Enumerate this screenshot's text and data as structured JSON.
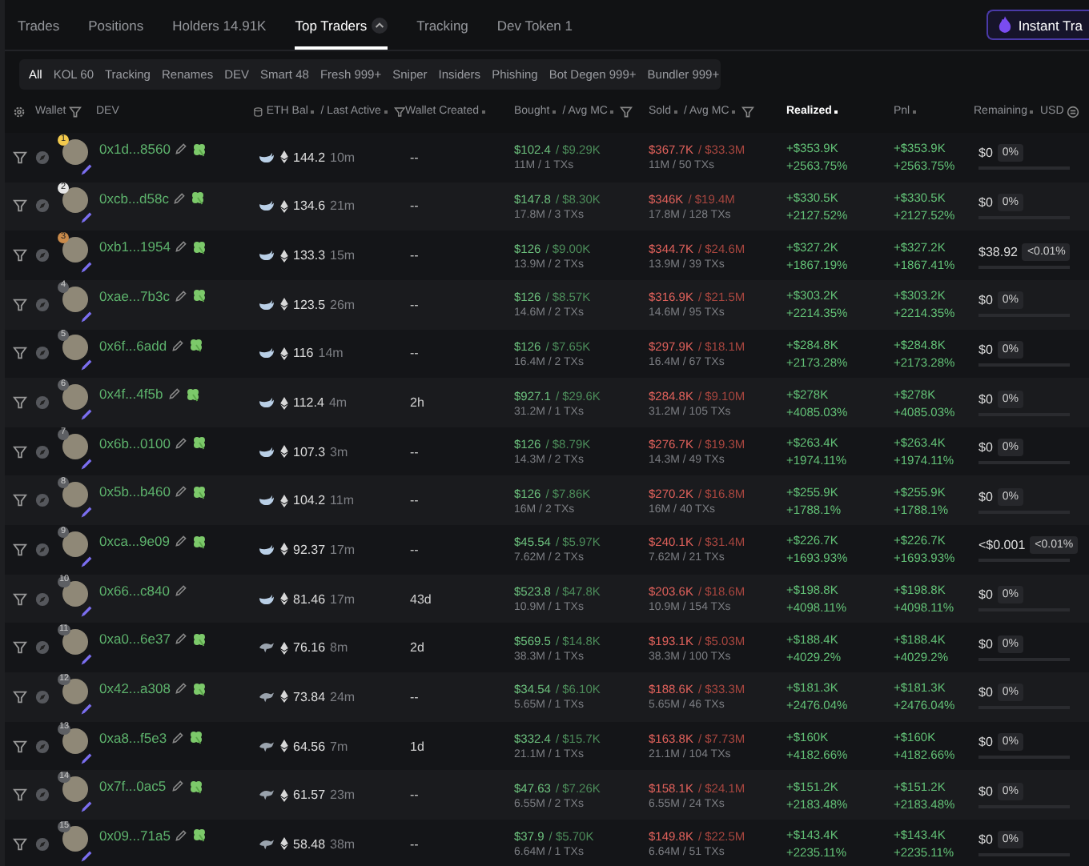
{
  "tabs": [
    {
      "label": "Trades",
      "selected": false
    },
    {
      "label": "Positions",
      "selected": false
    },
    {
      "label": "Holders 14.91K",
      "selected": false
    },
    {
      "label": "Top Traders",
      "selected": true,
      "caret": true
    },
    {
      "label": "Tracking",
      "selected": false
    },
    {
      "label": "Dev Token 1",
      "selected": false
    }
  ],
  "instant_trade_button": "Instant Tra",
  "filters": [
    {
      "label": "All",
      "selected": true
    },
    {
      "label": "KOL 60",
      "selected": false
    },
    {
      "label": "Tracking",
      "selected": false
    },
    {
      "label": "Renames",
      "selected": false
    },
    {
      "label": "DEV",
      "selected": false
    },
    {
      "label": "Smart 48",
      "selected": false
    },
    {
      "label": "Fresh 999+",
      "selected": false
    },
    {
      "label": "Sniper",
      "selected": false
    },
    {
      "label": "Insiders",
      "selected": false
    },
    {
      "label": "Phishing",
      "selected": false
    },
    {
      "label": "Bot Degen 999+",
      "selected": false
    },
    {
      "label": "Bundler 999+",
      "selected": false
    }
  ],
  "columns": {
    "wallet": "Wallet",
    "dev": "DEV",
    "eth_bal": "ETH Bal",
    "last_active": "/ Last Active",
    "wallet_created": "Wallet Created",
    "bought": "Bought",
    "bought_mc": "/ Avg MC",
    "sold": "Sold",
    "sold_mc": "/ Avg MC",
    "realized": "Realized",
    "pnl": "Pnl",
    "remaining": "Remaining",
    "usd": "USD"
  },
  "rows": [
    {
      "rank": "1",
      "wallet": "0x1d...8560",
      "tagged": true,
      "kind": "whale",
      "eth": "144.2",
      "active": "10m",
      "created": "--",
      "bought": "$102.4",
      "bought_mc": "/ $9.29K",
      "bought_sub": "11M / 1 TXs",
      "sold": "$367.7K",
      "sold_mc": "/ $33.3M",
      "sold_sub": "11M / 50 TXs",
      "realized": "+$353.9K",
      "realized_pct": "+2563.75%",
      "pnl": "+$353.9K",
      "pnl_pct": "+2563.75%",
      "remaining": "$0",
      "remaining_pct": "0%"
    },
    {
      "rank": "2",
      "wallet": "0xcb...d58c",
      "tagged": true,
      "kind": "whale",
      "eth": "134.6",
      "active": "21m",
      "created": "--",
      "bought": "$147.8",
      "bought_mc": "/ $8.30K",
      "bought_sub": "17.8M / 3 TXs",
      "sold": "$346K",
      "sold_mc": "/ $19.4M",
      "sold_sub": "17.8M / 128 TXs",
      "realized": "+$330.5K",
      "realized_pct": "+2127.52%",
      "pnl": "+$330.5K",
      "pnl_pct": "+2127.52%",
      "remaining": "$0",
      "remaining_pct": "0%"
    },
    {
      "rank": "3",
      "wallet": "0xb1...1954",
      "tagged": true,
      "kind": "whale",
      "eth": "133.3",
      "active": "15m",
      "created": "--",
      "bought": "$126",
      "bought_mc": "/ $9.00K",
      "bought_sub": "13.9M / 2 TXs",
      "sold": "$344.7K",
      "sold_mc": "/ $24.6M",
      "sold_sub": "13.9M / 39 TXs",
      "realized": "+$327.2K",
      "realized_pct": "+1867.19%",
      "pnl": "+$327.2K",
      "pnl_pct": "+1867.41%",
      "remaining": "$38.92",
      "remaining_pct": "<0.01%"
    },
    {
      "rank": "4",
      "wallet": "0xae...7b3c",
      "tagged": true,
      "kind": "whale",
      "eth": "123.5",
      "active": "26m",
      "created": "--",
      "bought": "$126",
      "bought_mc": "/ $8.57K",
      "bought_sub": "14.6M / 2 TXs",
      "sold": "$316.9K",
      "sold_mc": "/ $21.5M",
      "sold_sub": "14.6M / 95 TXs",
      "realized": "+$303.2K",
      "realized_pct": "+2214.35%",
      "pnl": "+$303.2K",
      "pnl_pct": "+2214.35%",
      "remaining": "$0",
      "remaining_pct": "0%"
    },
    {
      "rank": "5",
      "wallet": "0x6f...6add",
      "tagged": true,
      "kind": "whale",
      "eth": "116",
      "active": "14m",
      "created": "--",
      "bought": "$126",
      "bought_mc": "/ $7.65K",
      "bought_sub": "16.4M / 2 TXs",
      "sold": "$297.9K",
      "sold_mc": "/ $18.1M",
      "sold_sub": "16.4M / 67 TXs",
      "realized": "+$284.8K",
      "realized_pct": "+2173.28%",
      "pnl": "+$284.8K",
      "pnl_pct": "+2173.28%",
      "remaining": "$0",
      "remaining_pct": "0%"
    },
    {
      "rank": "6",
      "wallet": "0x4f...4f5b",
      "tagged": true,
      "kind": "whale",
      "eth": "112.4",
      "active": "4m",
      "created": "2h",
      "bought": "$927.1",
      "bought_mc": "/ $29.6K",
      "bought_sub": "31.2M / 1 TXs",
      "sold": "$284.8K",
      "sold_mc": "/ $9.10M",
      "sold_sub": "31.2M / 105 TXs",
      "realized": "+$278K",
      "realized_pct": "+4085.03%",
      "pnl": "+$278K",
      "pnl_pct": "+4085.03%",
      "remaining": "$0",
      "remaining_pct": "0%"
    },
    {
      "rank": "7",
      "wallet": "0x6b...0100",
      "tagged": true,
      "kind": "whale",
      "eth": "107.3",
      "active": "3m",
      "created": "--",
      "bought": "$126",
      "bought_mc": "/ $8.79K",
      "bought_sub": "14.3M / 2 TXs",
      "sold": "$276.7K",
      "sold_mc": "/ $19.3M",
      "sold_sub": "14.3M / 49 TXs",
      "realized": "+$263.4K",
      "realized_pct": "+1974.11%",
      "pnl": "+$263.4K",
      "pnl_pct": "+1974.11%",
      "remaining": "$0",
      "remaining_pct": "0%"
    },
    {
      "rank": "8",
      "wallet": "0x5b...b460",
      "tagged": true,
      "kind": "whale",
      "eth": "104.2",
      "active": "11m",
      "created": "--",
      "bought": "$126",
      "bought_mc": "/ $7.86K",
      "bought_sub": "16M / 2 TXs",
      "sold": "$270.2K",
      "sold_mc": "/ $16.8M",
      "sold_sub": "16M / 40 TXs",
      "realized": "+$255.9K",
      "realized_pct": "+1788.1%",
      "pnl": "+$255.9K",
      "pnl_pct": "+1788.1%",
      "remaining": "$0",
      "remaining_pct": "0%"
    },
    {
      "rank": "9",
      "wallet": "0xca...9e09",
      "tagged": true,
      "kind": "whale",
      "eth": "92.37",
      "active": "17m",
      "created": "--",
      "bought": "$45.54",
      "bought_mc": "/ $5.97K",
      "bought_sub": "7.62M / 2 TXs",
      "sold": "$240.1K",
      "sold_mc": "/ $31.4M",
      "sold_sub": "7.62M / 21 TXs",
      "realized": "+$226.7K",
      "realized_pct": "+1693.93%",
      "pnl": "+$226.7K",
      "pnl_pct": "+1693.93%",
      "remaining": "<$0.001",
      "remaining_pct": "<0.01%"
    },
    {
      "rank": "10",
      "wallet": "0x66...c840",
      "tagged": false,
      "kind": "whale",
      "eth": "81.46",
      "active": "17m",
      "created": "43d",
      "bought": "$523.8",
      "bought_mc": "/ $47.8K",
      "bought_sub": "10.9M / 1 TXs",
      "sold": "$203.6K",
      "sold_mc": "/ $18.6M",
      "sold_sub": "10.9M / 154 TXs",
      "realized": "+$198.8K",
      "realized_pct": "+4098.11%",
      "pnl": "+$198.8K",
      "pnl_pct": "+4098.11%",
      "remaining": "$0",
      "remaining_pct": "0%"
    },
    {
      "rank": "11",
      "wallet": "0xa0...6e37",
      "tagged": true,
      "kind": "dolphin",
      "eth": "76.16",
      "active": "8m",
      "created": "2d",
      "bought": "$569.5",
      "bought_mc": "/ $14.8K",
      "bought_sub": "38.3M / 1 TXs",
      "sold": "$193.1K",
      "sold_mc": "/ $5.03M",
      "sold_sub": "38.3M / 100 TXs",
      "realized": "+$188.4K",
      "realized_pct": "+4029.2%",
      "pnl": "+$188.4K",
      "pnl_pct": "+4029.2%",
      "remaining": "$0",
      "remaining_pct": "0%"
    },
    {
      "rank": "12",
      "wallet": "0x42...a308",
      "tagged": true,
      "kind": "dolphin",
      "eth": "73.84",
      "active": "24m",
      "created": "--",
      "bought": "$34.54",
      "bought_mc": "/ $6.10K",
      "bought_sub": "5.65M / 1 TXs",
      "sold": "$188.6K",
      "sold_mc": "/ $33.3M",
      "sold_sub": "5.65M / 46 TXs",
      "realized": "+$181.3K",
      "realized_pct": "+2476.04%",
      "pnl": "+$181.3K",
      "pnl_pct": "+2476.04%",
      "remaining": "$0",
      "remaining_pct": "0%"
    },
    {
      "rank": "13",
      "wallet": "0xa8...f5e3",
      "tagged": true,
      "kind": "dolphin",
      "eth": "64.56",
      "active": "7m",
      "created": "1d",
      "bought": "$332.4",
      "bought_mc": "/ $15.7K",
      "bought_sub": "21.1M / 1 TXs",
      "sold": "$163.8K",
      "sold_mc": "/ $7.73M",
      "sold_sub": "21.1M / 104 TXs",
      "realized": "+$160K",
      "realized_pct": "+4182.66%",
      "pnl": "+$160K",
      "pnl_pct": "+4182.66%",
      "remaining": "$0",
      "remaining_pct": "0%"
    },
    {
      "rank": "14",
      "wallet": "0x7f...0ac5",
      "tagged": true,
      "kind": "dolphin",
      "eth": "61.57",
      "active": "23m",
      "created": "--",
      "bought": "$47.63",
      "bought_mc": "/ $7.26K",
      "bought_sub": "6.55M / 2 TXs",
      "sold": "$158.1K",
      "sold_mc": "/ $24.1M",
      "sold_sub": "6.55M / 24 TXs",
      "realized": "+$151.2K",
      "realized_pct": "+2183.48%",
      "pnl": "+$151.2K",
      "pnl_pct": "+2183.48%",
      "remaining": "$0",
      "remaining_pct": "0%"
    },
    {
      "rank": "15",
      "wallet": "0x09...71a5",
      "tagged": true,
      "kind": "dolphin",
      "eth": "58.48",
      "active": "38m",
      "created": "--",
      "bought": "$37.9",
      "bought_mc": "/ $5.70K",
      "bought_sub": "6.64M / 1 TXs",
      "sold": "$149.8K",
      "sold_mc": "/ $22.5M",
      "sold_sub": "6.64M / 51 TXs",
      "realized": "+$143.4K",
      "realized_pct": "+2235.11%",
      "pnl": "+$143.4K",
      "pnl_pct": "+2235.11%",
      "remaining": "$0",
      "remaining_pct": "0%"
    }
  ]
}
